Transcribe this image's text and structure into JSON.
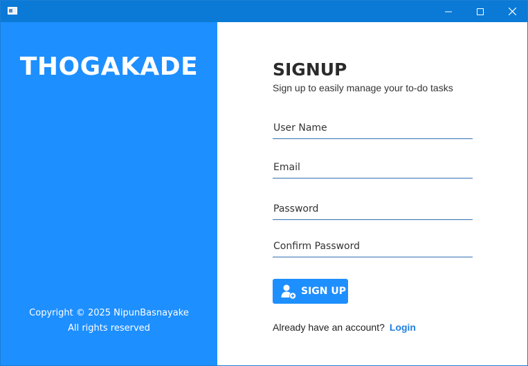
{
  "window": {
    "controls": [
      "minimize",
      "maximize",
      "close"
    ]
  },
  "sidebar": {
    "brand": "THOGAKADE",
    "copyright_line1": "Copyright © 2025 NipunBasnayake",
    "copyright_line2": "All rights reserved"
  },
  "form": {
    "title": "SIGNUP",
    "subtitle": "Sign up to easily manage your to-do tasks",
    "fields": [
      {
        "placeholder": "User Name",
        "value": ""
      },
      {
        "placeholder": "Email",
        "value": ""
      },
      {
        "placeholder": "Password",
        "value": ""
      },
      {
        "placeholder": "Confirm Password",
        "value": ""
      }
    ],
    "signup_label": "SIGN UP",
    "signup_icon": "user-plus-icon",
    "account_prompt": "Already have an account?",
    "login_label": "Login"
  },
  "colors": {
    "titlebar": "#0a7ad6",
    "accent": "#1e8fff",
    "link": "#1e7fe0",
    "field_underline": "#2f6fb0"
  }
}
